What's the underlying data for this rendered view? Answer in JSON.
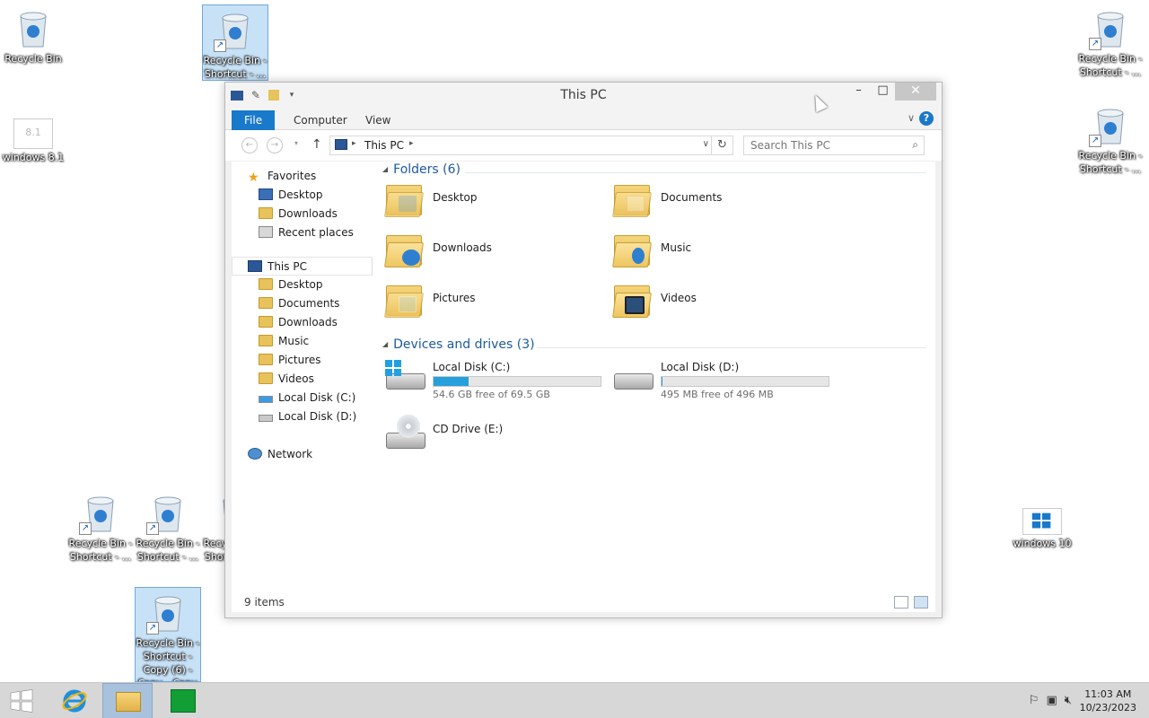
{
  "desktop": {
    "icons": [
      {
        "label": "Recycle Bin"
      },
      {
        "label": "Recycle Bin - Shortcut - ..."
      },
      {
        "label": "Recycle Bin - Shortcut - ..."
      },
      {
        "label": "windows 8.1"
      },
      {
        "label": "Recycle Bin - Shortcut - ..."
      },
      {
        "label": "Recycle Bin - Shortcut - ..."
      },
      {
        "label": "Recycle Bin - Shortcut - ..."
      },
      {
        "label": "Recycle Bin - Shortcut - ..."
      },
      {
        "label": "windows 10"
      },
      {
        "label": "Recycle Bin - Shortcut - Copy (6) - Copy - Copy"
      }
    ],
    "windows81_badge": "8.1"
  },
  "window": {
    "title": "This PC",
    "ribbon_tabs": [
      "File",
      "Computer",
      "View"
    ],
    "help_glyph": "?",
    "address": {
      "crumb": "This PC"
    },
    "search": {
      "placeholder": "Search This PC"
    },
    "nav": {
      "favorites": "Favorites",
      "fav_items": [
        "Desktop",
        "Downloads",
        "Recent places"
      ],
      "this_pc": "This PC",
      "pc_items": [
        "Desktop",
        "Documents",
        "Downloads",
        "Music",
        "Pictures",
        "Videos",
        "Local Disk (C:)",
        "Local Disk (D:)"
      ],
      "network": "Network"
    },
    "folders_header": "Folders (6)",
    "folders": [
      "Desktop",
      "Documents",
      "Downloads",
      "Music",
      "Pictures",
      "Videos"
    ],
    "devices_header": "Devices and drives (3)",
    "drives": [
      {
        "name": "Local Disk (C:)",
        "free": "54.6 GB free of 69.5 GB",
        "used_fraction": 0.21
      },
      {
        "name": "Local Disk (D:)",
        "free": "495 MB free of 496 MB",
        "used_fraction": 0.002
      },
      {
        "name": "CD Drive (E:)"
      }
    ],
    "status": {
      "count": "9 items"
    }
  },
  "taskbar": {
    "clock_time": "11:03 AM",
    "clock_date": "10/23/2023"
  },
  "colors": {
    "accent": "#1979ca",
    "drive_bar": "#26a0da"
  }
}
